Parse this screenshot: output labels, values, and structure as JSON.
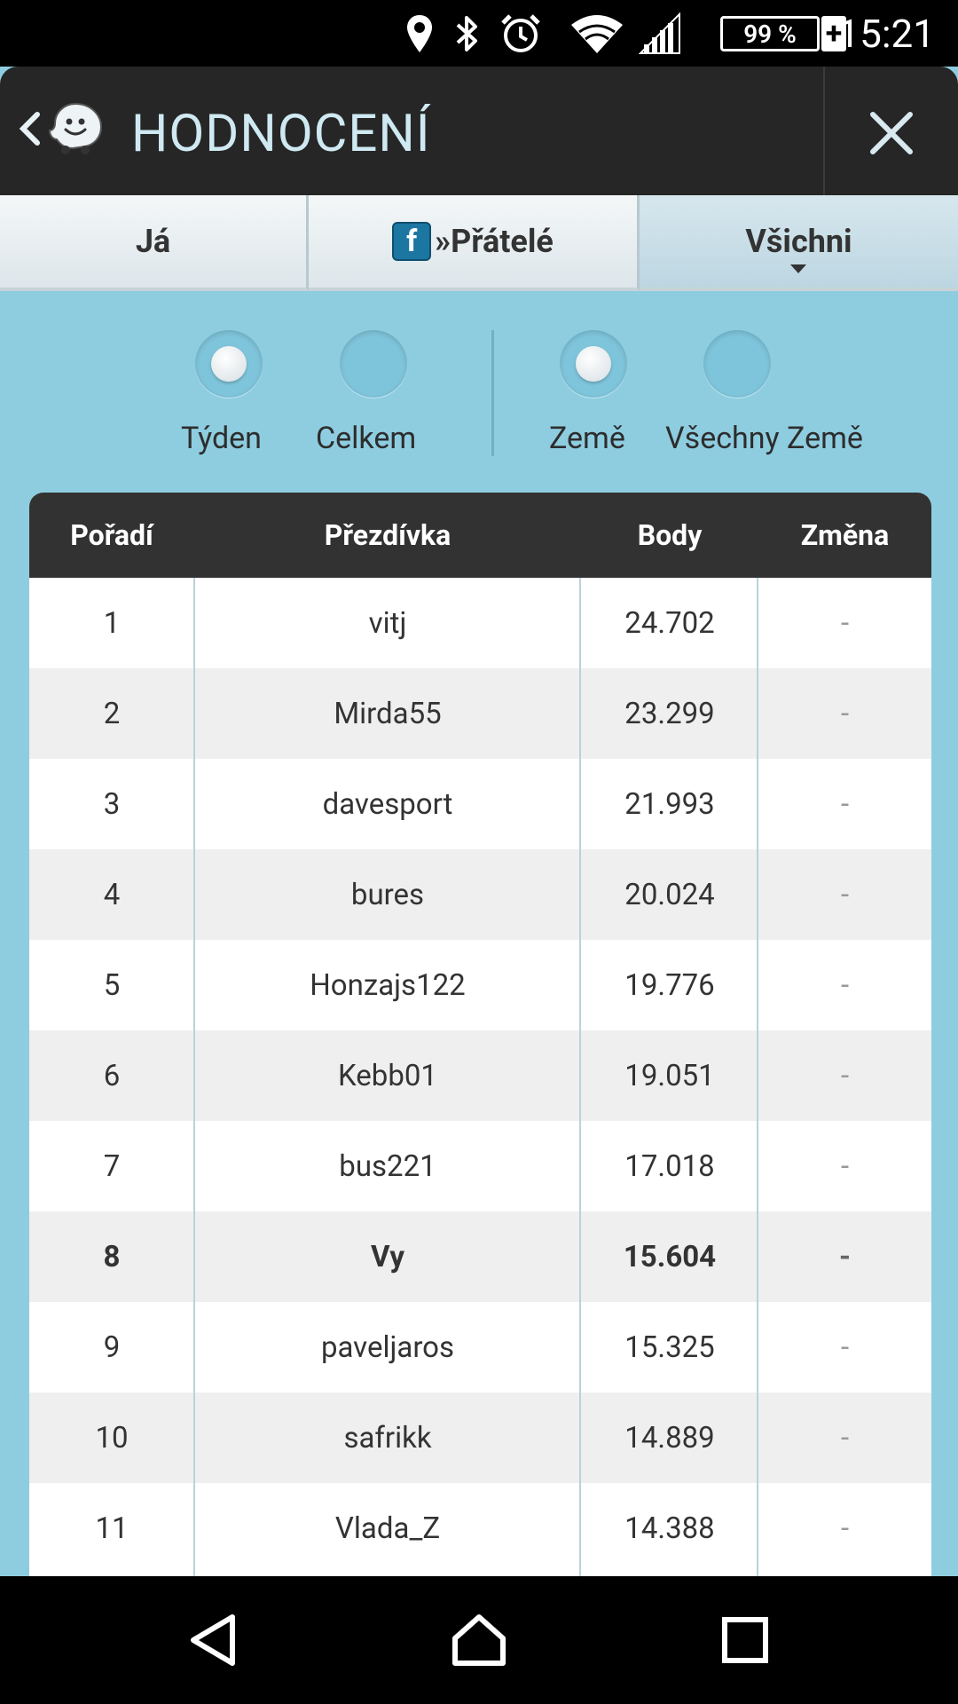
{
  "status_bar": {
    "time": "15:21",
    "battery_percent": "99 %",
    "icons": [
      "location-icon",
      "bluetooth-icon",
      "alarm-icon",
      "wifi-icon",
      "signal-icon",
      "battery-icon"
    ]
  },
  "app_bar": {
    "title": "HODNOCENÍ",
    "logo": "waze-logo-icon",
    "back": "back-chevron-icon",
    "close": "close-icon"
  },
  "tabs": [
    {
      "label": "Já",
      "selected": false
    },
    {
      "label": "»Přátelé",
      "icon": "facebook-icon",
      "icon_text": "f",
      "selected": false
    },
    {
      "label": "Všichni",
      "selected": true
    }
  ],
  "filters": {
    "period": [
      {
        "label": "Týden",
        "selected": true
      },
      {
        "label": "Celkem",
        "selected": false
      }
    ],
    "scope": [
      {
        "label": "Země",
        "selected": true
      },
      {
        "label": "Všechny Země",
        "selected": false
      }
    ]
  },
  "table": {
    "headers": [
      "Pořadí",
      "Přezdívka",
      "Body",
      "Změna"
    ],
    "rows": [
      {
        "rank": "1",
        "nick": "vitj",
        "points": "24.702",
        "change": "-"
      },
      {
        "rank": "2",
        "nick": "Mirda55",
        "points": "23.299",
        "change": "-"
      },
      {
        "rank": "3",
        "nick": "davesport",
        "points": "21.993",
        "change": "-"
      },
      {
        "rank": "4",
        "nick": "bures",
        "points": "20.024",
        "change": "-"
      },
      {
        "rank": "5",
        "nick": "Honzajs122",
        "points": "19.776",
        "change": "-"
      },
      {
        "rank": "6",
        "nick": "Kebb01",
        "points": "19.051",
        "change": "-"
      },
      {
        "rank": "7",
        "nick": "bus221",
        "points": "17.018",
        "change": "-"
      },
      {
        "rank": "8",
        "nick": "Vy",
        "points": "15.604",
        "change": "-",
        "current_user": true
      },
      {
        "rank": "9",
        "nick": "paveljaros",
        "points": "15.325",
        "change": "-"
      },
      {
        "rank": "10",
        "nick": "safrikk",
        "points": "14.889",
        "change": "-"
      },
      {
        "rank": "11",
        "nick": "Vlada_Z",
        "points": "14.388",
        "change": "-"
      }
    ]
  },
  "nav_bar": {
    "icons": [
      "back-triangle-icon",
      "home-icon",
      "recents-icon"
    ]
  },
  "colors": {
    "background": "#8ecde0",
    "app_bar": "#262626",
    "table_header": "#323232",
    "title_text": "#cfe9f2"
  }
}
